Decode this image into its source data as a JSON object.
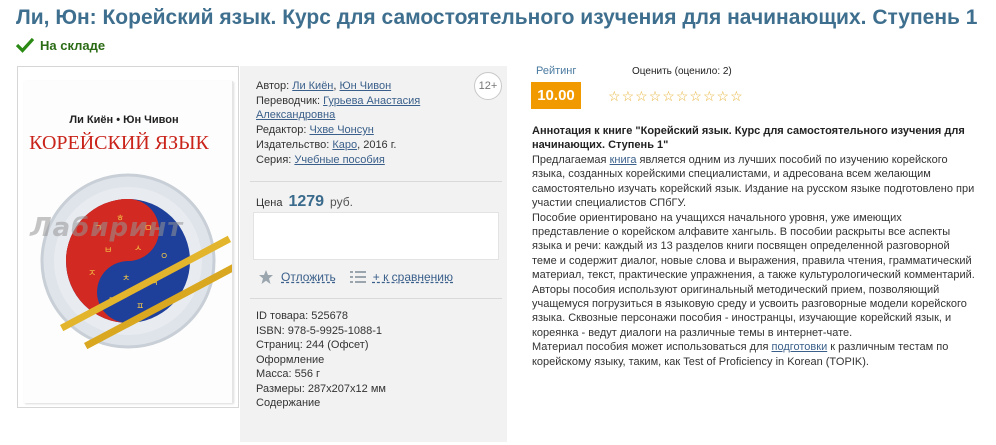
{
  "title": "Ли, Юн: Корейский язык. Курс для самостоятельного изучения для начинающих. Ступень 1",
  "stock_label": "На складе",
  "cover": {
    "authors_line": "Ли Киён • Юн Чивон",
    "book_title": "КОРЕЙСКИЙ ЯЗЫК",
    "watermark": "Лабиринт"
  },
  "age_rating": "12+",
  "meta": {
    "author_label": "Автор:",
    "authors": [
      "Ли Киён",
      "Юн Чивон"
    ],
    "translator_label": "Переводчик:",
    "translator": "Гурьева Анастасия Александровна",
    "editor_label": "Редактор:",
    "editor": "Чхве Чонсун",
    "publisher_label": "Издательство:",
    "publisher": "Каро",
    "year": ", 2016 г.",
    "series_label": "Серия:",
    "series": "Учебные пособия"
  },
  "price": {
    "label": "Цена",
    "value": "1279",
    "currency": "руб."
  },
  "actions": {
    "defer": "Отложить",
    "compare": "+ к сравнению"
  },
  "specs": {
    "id": "ID товара: 525678",
    "isbn": "ISBN: 978-5-9925-1088-1",
    "pages": "Страниц: 244 (Офсет)",
    "design_link": "Оформление",
    "weight": "Масса: 556 г",
    "size": "Размеры: 287x207x12 мм",
    "contents_link": "Содержание"
  },
  "rating": {
    "label": "Рейтинг",
    "value": "10.00",
    "rate_label": "Оценить (оценило: 2)",
    "stars_total": 10
  },
  "annotation": {
    "heading": "Аннотация к книге \"Корейский язык. Курс для самостоятельного изучения для начинающих. Ступень 1\"",
    "p1_before": "Предлагаемая ",
    "p1_link": "книга",
    "p1_after": " является одним из лучших пособий по изучению корейского языка, созданных корейскими специалистами, и адресована всем желающим самостоятельно изучать корейский язык. Издание на русском языке подготовлено при участии специалистов СПбГУ.",
    "p2": "Пособие ориентировано на учащихся начального уровня, уже имеющих представление о корейском алфавите хангыль. В пособии раскрыты все аспекты языка и речи: каждый из 13 разделов книги посвящен определенной разговорной теме и содержит диалог, новые слова и выражения, правила чтения, грамматический материал, текст, практические упражнения, а также культурологический комментарий.",
    "p3": "Авторы пособия используют оригинальный методический прием, позволяющий учащемуся погрузиться в языковую среду и усвоить разговорные модели корейского языка. Сквозные персонажи пособия - иностранцы, изучающие корейский язык, и кореянка - ведут диалоги на различные темы в интернет-чате.",
    "p4_before": "Материал пособия может использоваться для ",
    "p4_link": "подготовки",
    "p4_after": " к различным тестам по корейскому языку, таким, как Test of Proficiency in Korean (TOPIK)."
  },
  "colors": {
    "title": "#3f6f8e",
    "stock": "#2a6b14",
    "rating_badge": "#f19a00",
    "star": "#e7b43a",
    "link": "#3a5f8a"
  }
}
